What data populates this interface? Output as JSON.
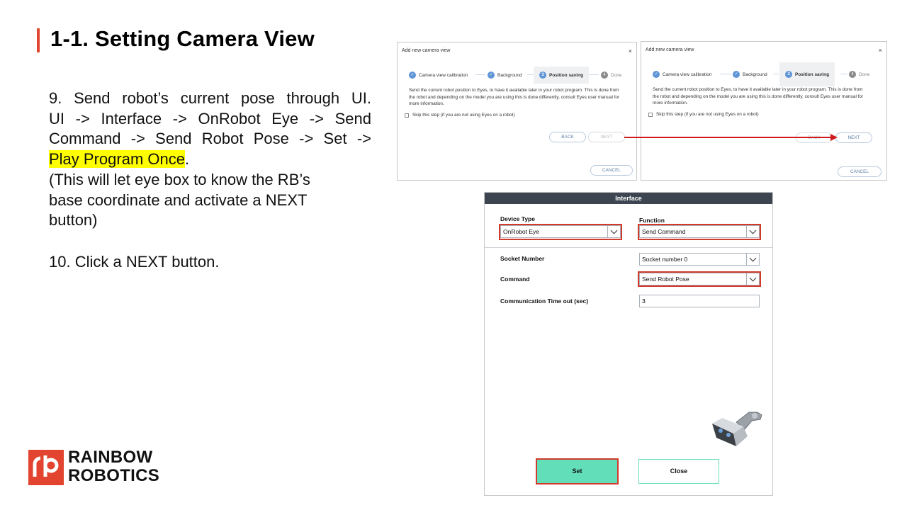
{
  "slide": {
    "title": "1-1. Setting Camera View",
    "instructions": {
      "line1": "9. Send robot’s current pose through UI.",
      "line2": "UI -> Interface -> OnRobot Eye -> Send",
      "line3": "Command -> Send Robot Pose -> Set ->",
      "line4_highlight": "Play Program Once",
      "line4_end": ".",
      "line5": "(This will let eye box to know the RB’s",
      "line6": "base coordinate and activate a NEXT",
      "line7": "button)",
      "line8": "10. Click a NEXT button."
    },
    "highlight_color": "#ffff00"
  },
  "logo": {
    "line1": "RAINBOW",
    "line2": "ROBOTICS",
    "mark": "rb",
    "color": "#e2442f"
  },
  "dialog": {
    "title": "Add new camera view",
    "close_glyph": "×",
    "steps": [
      {
        "num": "✓",
        "label": "Camera view calibration"
      },
      {
        "num": "✓",
        "label": "Background"
      },
      {
        "num": "3",
        "label": "Position saving"
      },
      {
        "num": "4",
        "label": "Done"
      }
    ],
    "message": "Send the current robot position to Eyes, to have it available later in your robot program. This is done from the robot and depending on the model you are using this is done differently, consult Eyes user manual for more information.",
    "skip_label": "Skip this step (if you are not using Eyes on a robot)",
    "back_label": "BACK",
    "next_label": "NEXT",
    "cancel_label": "CANCEL",
    "accent_color": "#5f94d6"
  },
  "interface": {
    "header": "Interface",
    "device_type_label": "Device Type",
    "device_type_value": "OnRobot Eye",
    "function_label": "Function",
    "function_value": "Send Command",
    "socket_label": "Socket Number",
    "socket_value": "Socket number 0",
    "command_label": "Command",
    "command_value": "Send Robot Pose",
    "timeout_label": "Communication Time out (sec)",
    "timeout_value": "3",
    "set_label": "Set",
    "close_label": "Close",
    "set_color": "#62dfb9",
    "highlight_box_color": "#d23a2c"
  }
}
